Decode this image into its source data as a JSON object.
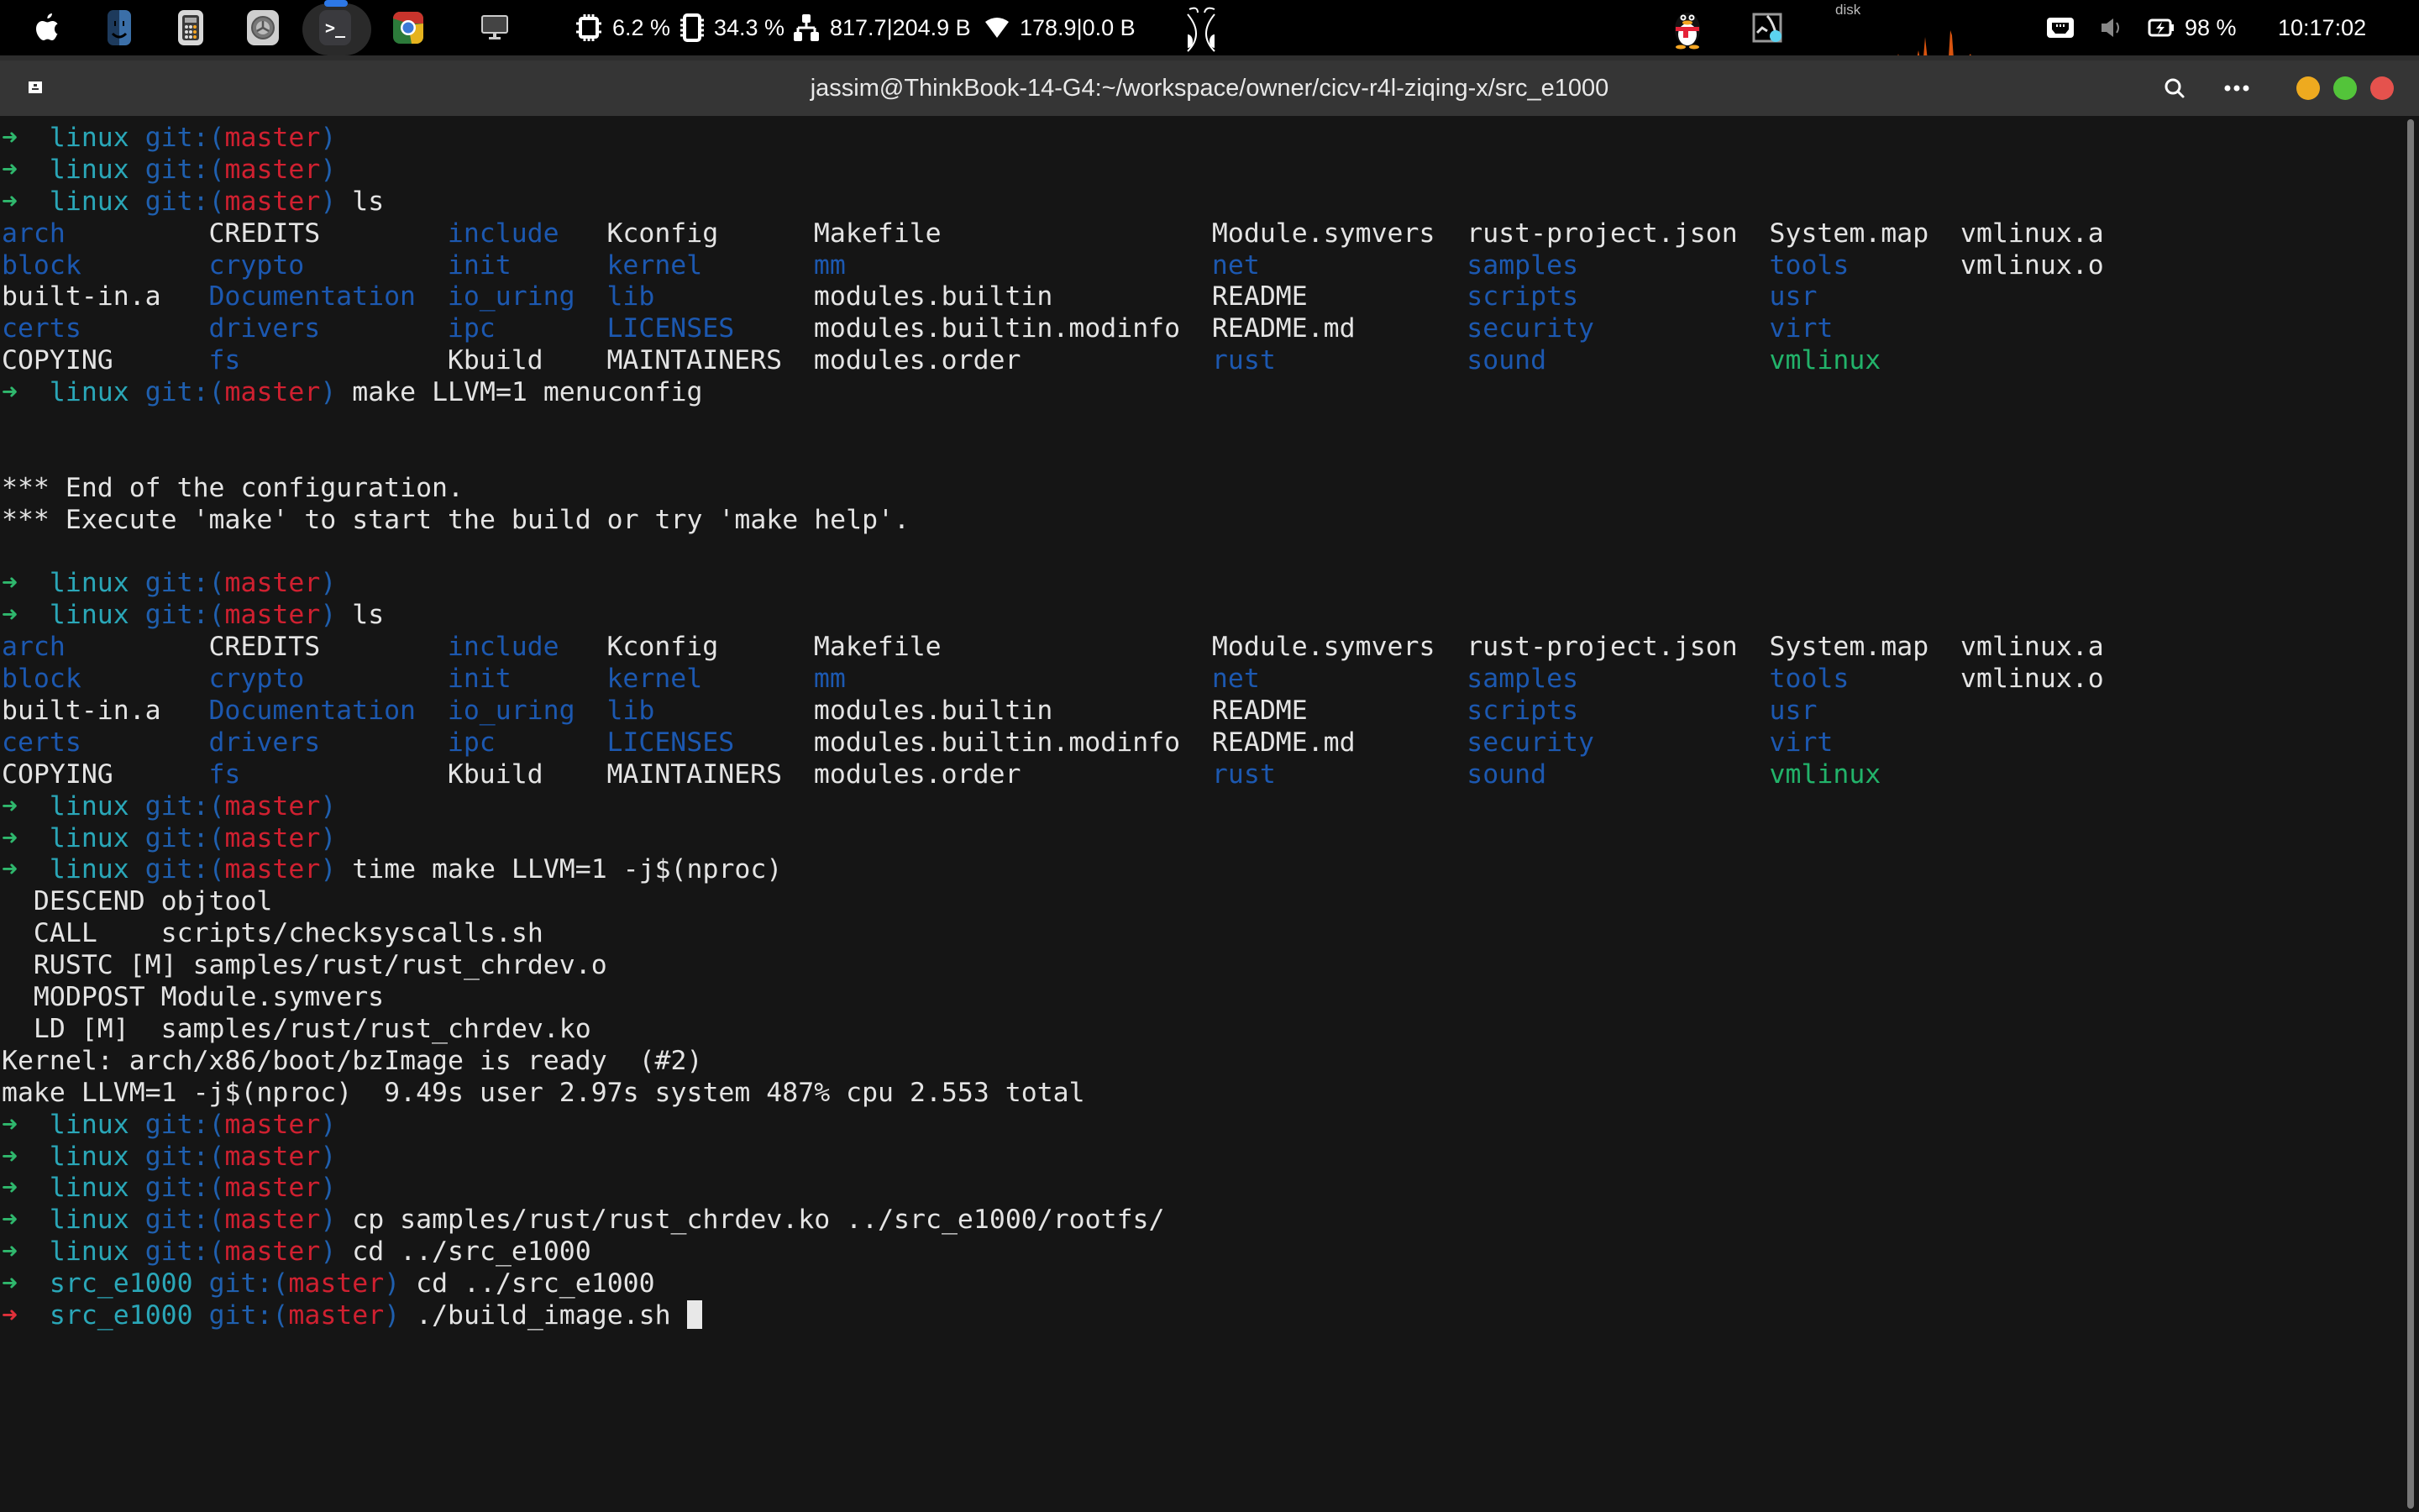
{
  "menubar": {
    "dock": [
      {
        "name": "apple-menu",
        "icon": "apple-icon",
        "glyph": ""
      },
      {
        "name": "finder",
        "icon": "finder-icon",
        "glyph": "☺"
      },
      {
        "name": "calculator",
        "icon": "calculator-icon",
        "glyph": "▦"
      },
      {
        "name": "system-preferences",
        "icon": "gear-icon",
        "glyph": "⚙"
      },
      {
        "name": "terminal",
        "icon": "terminal-icon",
        "glyph": ">_",
        "active": true
      },
      {
        "name": "chrome",
        "icon": "chrome-icon",
        "glyph": "◉"
      },
      {
        "name": "display",
        "icon": "monitor-icon",
        "glyph": "🖵"
      }
    ],
    "stats": {
      "cpu": "6.2 %",
      "memory": "34.3 %",
      "network": "817.7|204.9 B",
      "wifi": "178.9|0.0 B"
    },
    "disk_label": "disk",
    "battery": "98 %",
    "clock": "10:17:02"
  },
  "window": {
    "title": "jassim@ThinkBook-14-G4:~/workspace/owner/cicv-r4l-ziqing-x/src_e1000",
    "colors": {
      "minimize": "#eeaa1f",
      "maximize": "#53c43a",
      "close": "#e5524d"
    }
  },
  "prompt": {
    "arrow": "➜",
    "git_open": "git:(",
    "branch": "master",
    "git_close": ")"
  },
  "ls_output": {
    "rows": [
      [
        [
          "arch",
          "blue"
        ],
        [
          "CREDITS",
          "white"
        ],
        [
          "include",
          "blue"
        ],
        [
          "Kconfig",
          "white"
        ],
        [
          "Makefile",
          "white"
        ],
        [
          "Module.symvers",
          "white"
        ],
        [
          "rust-project.json",
          "white"
        ],
        [
          "System.map",
          "white"
        ],
        [
          "vmlinux.a",
          "white"
        ]
      ],
      [
        [
          "block",
          "blue"
        ],
        [
          "crypto",
          "blue"
        ],
        [
          "init",
          "blue"
        ],
        [
          "kernel",
          "blue"
        ],
        [
          "mm",
          "blue"
        ],
        [
          "net",
          "blue"
        ],
        [
          "samples",
          "blue"
        ],
        [
          "tools",
          "blue"
        ],
        [
          "vmlinux.o",
          "white"
        ]
      ],
      [
        [
          "built-in.a",
          "white"
        ],
        [
          "Documentation",
          "blue"
        ],
        [
          "io_uring",
          "blue"
        ],
        [
          "lib",
          "blue"
        ],
        [
          "modules.builtin",
          "white"
        ],
        [
          "README",
          "white"
        ],
        [
          "scripts",
          "blue"
        ],
        [
          "usr",
          "blue"
        ],
        [
          "",
          ""
        ]
      ],
      [
        [
          "certs",
          "blue"
        ],
        [
          "drivers",
          "blue"
        ],
        [
          "ipc",
          "blue"
        ],
        [
          "LICENSES",
          "blue"
        ],
        [
          "modules.builtin.modinfo",
          "white"
        ],
        [
          "README.md",
          "white"
        ],
        [
          "security",
          "blue"
        ],
        [
          "virt",
          "blue"
        ],
        [
          "",
          ""
        ]
      ],
      [
        [
          "COPYING",
          "white"
        ],
        [
          "fs",
          "blue"
        ],
        [
          "Kbuild",
          "white"
        ],
        [
          "MAINTAINERS",
          "white"
        ],
        [
          "modules.order",
          "white"
        ],
        [
          "rust",
          "blue"
        ],
        [
          "sound",
          "blue"
        ],
        [
          "vmlinux",
          "green"
        ],
        [
          "",
          ""
        ]
      ]
    ]
  },
  "terminal": {
    "lines": [
      {
        "type": "prompt",
        "dir": "linux",
        "cmd": ""
      },
      {
        "type": "prompt",
        "dir": "linux",
        "cmd": ""
      },
      {
        "type": "prompt",
        "dir": "linux",
        "cmd": "ls"
      },
      {
        "type": "ls"
      },
      {
        "type": "prompt",
        "dir": "linux",
        "cmd": "make LLVM=1 menuconfig"
      },
      {
        "type": "text",
        "text": ""
      },
      {
        "type": "text",
        "text": ""
      },
      {
        "type": "text",
        "text": "*** End of the configuration."
      },
      {
        "type": "text",
        "text": "*** Execute 'make' to start the build or try 'make help'."
      },
      {
        "type": "text",
        "text": ""
      },
      {
        "type": "prompt",
        "dir": "linux",
        "cmd": ""
      },
      {
        "type": "prompt",
        "dir": "linux",
        "cmd": "ls"
      },
      {
        "type": "ls"
      },
      {
        "type": "prompt",
        "dir": "linux",
        "cmd": ""
      },
      {
        "type": "prompt",
        "dir": "linux",
        "cmd": ""
      },
      {
        "type": "prompt",
        "dir": "linux",
        "cmd": "time make LLVM=1 -j$(nproc)"
      },
      {
        "type": "text",
        "text": "  DESCEND objtool"
      },
      {
        "type": "text",
        "text": "  CALL    scripts/checksyscalls.sh"
      },
      {
        "type": "text",
        "text": "  RUSTC [M] samples/rust/rust_chrdev.o"
      },
      {
        "type": "text",
        "text": "  MODPOST Module.symvers"
      },
      {
        "type": "text",
        "text": "  LD [M]  samples/rust/rust_chrdev.ko"
      },
      {
        "type": "text",
        "text": "Kernel: arch/x86/boot/bzImage is ready  (#2)"
      },
      {
        "type": "text",
        "text": "make LLVM=1 -j$(nproc)  9.49s user 2.97s system 487% cpu 2.553 total"
      },
      {
        "type": "prompt",
        "dir": "linux",
        "cmd": ""
      },
      {
        "type": "prompt",
        "dir": "linux",
        "cmd": ""
      },
      {
        "type": "prompt",
        "dir": "linux",
        "cmd": ""
      },
      {
        "type": "prompt",
        "dir": "linux",
        "cmd": "cp samples/rust/rust_chrdev.ko ../src_e1000/rootfs/"
      },
      {
        "type": "prompt",
        "dir": "linux",
        "cmd": "cd ../src_e1000"
      },
      {
        "type": "prompt",
        "dir": "src_e1000",
        "cmd": "cd ../src_e1000"
      },
      {
        "type": "prompt",
        "dir": "src_e1000",
        "cmd": "./build_image.sh ",
        "error": true,
        "cursor": true
      }
    ]
  }
}
